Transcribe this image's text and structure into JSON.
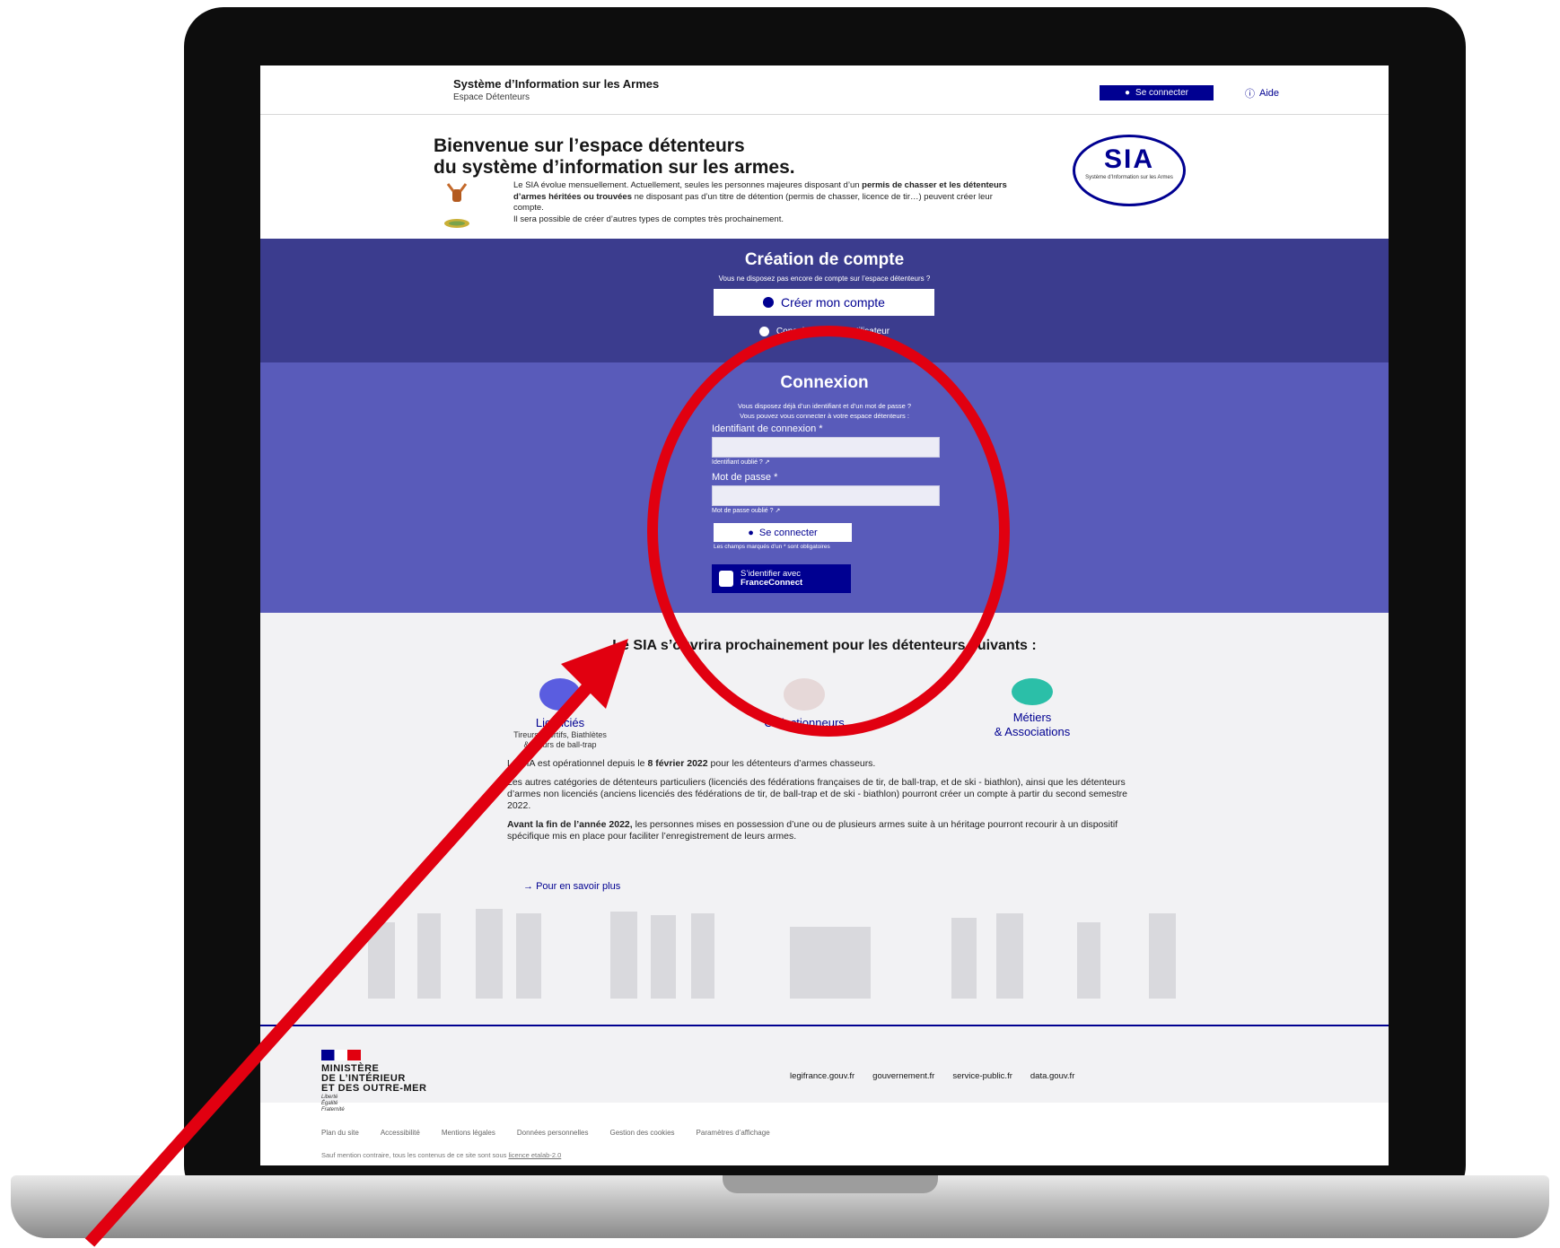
{
  "header": {
    "title": "Système d’Information sur les Armes",
    "subtitle": "Espace Détenteurs",
    "login_button": "Se connecter",
    "help_link": "Aide"
  },
  "welcome": {
    "heading_line1": "Bienvenue sur l’espace détenteurs",
    "heading_line2": "du système d’information sur les armes.",
    "p1_a": "Le SIA évolue mensuellement. Actuellement, seules les personnes majeures disposant d’un ",
    "p1_b": "permis de chasser et les détenteurs d’armes héritées ou trouvées",
    "p1_c": " ne disposant pas d’un titre de détention (permis de chasser, licence de tir…) peuvent créer leur compte.",
    "p2": "Il sera possible de créer d’autres types de comptes très prochainement.",
    "logo_text": "SIA",
    "logo_sub": "Système d’Information sur les Armes"
  },
  "creation": {
    "title": "Création de compte",
    "subtitle": "Vous ne disposez pas encore de compte sur l’espace détenteurs ?",
    "button": "Créer mon compte",
    "guide_link": "Consulter le guide utilisateur"
  },
  "login": {
    "title": "Connexion",
    "intro1": "Vous disposez déjà d’un identifiant et d’un mot de passe ?",
    "intro2": "Vous pouvez vous connecter à votre espace détenteurs :",
    "id_label": "Identifiant de connexion *",
    "id_forgot": "Identifiant oublié ?",
    "pwd_label": "Mot de passe *",
    "pwd_forgot": "Mot de passe oublié ?",
    "button": "Se connecter",
    "required_note": "Les champs marqués d’un * sont obligatoires",
    "fc_line1": "S’identifier avec",
    "fc_line2": "FranceConnect"
  },
  "upcoming": {
    "title": "Le SIA s’ouvrira prochainement pour les détenteurs suivants :",
    "categories": [
      {
        "label": "Licenciés",
        "sub1": "Tireurs sportifs, Biathlètes",
        "sub2": "& tireurs de ball-trap"
      },
      {
        "label": "Collectionneurs",
        "sub1": "",
        "sub2": ""
      },
      {
        "label": "Métiers",
        "sub1": "& Associations",
        "sub2": ""
      }
    ],
    "para1_a": "Le SIA est opérationnel depuis le ",
    "para1_b": "8 février 2022",
    "para1_c": " pour les détenteurs d’armes chasseurs.",
    "para2": "Les autres catégories de détenteurs particuliers (licenciés des fédérations françaises de tir, de ball-trap, et de ski - biathlon), ainsi que les détenteurs d’armes non licenciés (anciens licenciés des fédérations de tir, de ball-trap et de ski - biathlon) pourront créer un compte à partir du second semestre 2022.",
    "para3_a": "Avant la fin de l’année 2022,",
    "para3_b": " les personnes mises en possession d’une ou de plusieurs armes suite à un héritage pourront recourir à un dispositif spécifique mis en place pour faciliter l’enregistrement de leurs armes.",
    "more_link": "Pour en savoir plus"
  },
  "footer": {
    "ministry_line1": "MINISTÈRE",
    "ministry_line2": "DE L’INTÉRIEUR",
    "ministry_line3": "ET DES OUTRE-MER",
    "motto1": "Liberté",
    "motto2": "Égalité",
    "motto3": "Fraternité",
    "links": [
      "legifrance.gouv.fr",
      "gouvernement.fr",
      "service-public.fr",
      "data.gouv.fr"
    ],
    "bottom_links": [
      "Plan du site",
      "Accessibilité",
      "Mentions légales",
      "Données personnelles",
      "Gestion des cookies",
      "Paramètres d’affichage"
    ],
    "license_prefix": "Sauf mention contraire, tous les contenus de ce site sont sous ",
    "license_link": "licence etalab-2.0"
  },
  "colors": {
    "primary_blue": "#000091",
    "dark_section": "#3b3c8e",
    "login_section": "#595bba",
    "annotation_red": "#e10010"
  }
}
